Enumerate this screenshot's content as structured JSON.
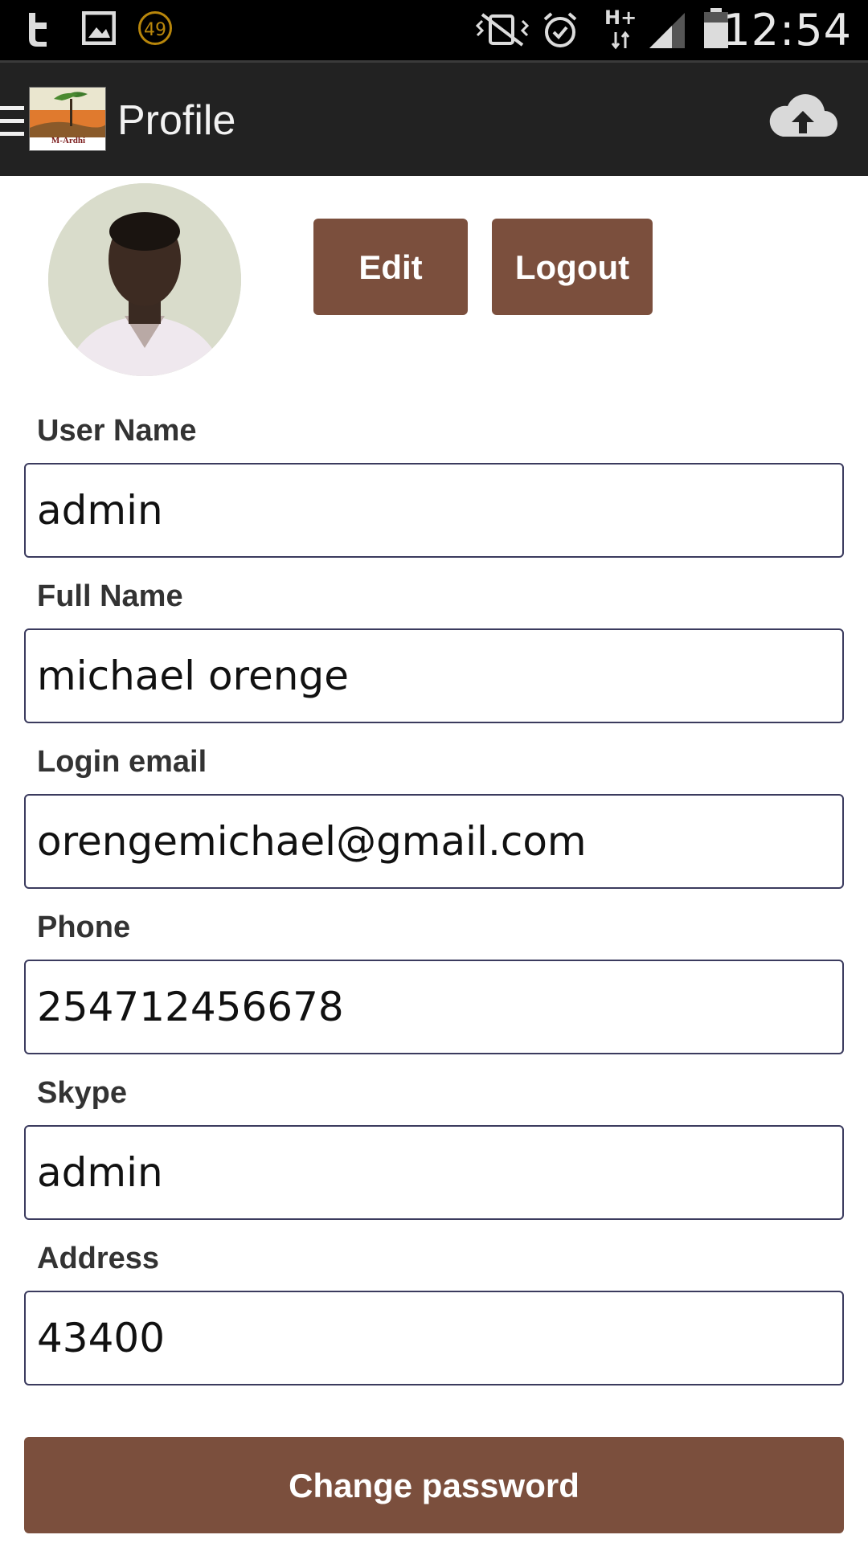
{
  "status_bar": {
    "time": "12:54",
    "badge_count": "49",
    "network_label": "H+",
    "icons": [
      "app-t-icon",
      "gallery-icon",
      "badge-49-icon",
      "vibrate-icon",
      "alarm-icon",
      "network-icon",
      "signal-icon",
      "battery-icon"
    ]
  },
  "app_bar": {
    "title": "Profile",
    "logo_text": "M-Ardhi",
    "icons": [
      "menu-icon",
      "cloud-upload-icon"
    ]
  },
  "profile": {
    "edit_label": "Edit",
    "logout_label": "Logout"
  },
  "fields": [
    {
      "label": "User Name",
      "value": "admin"
    },
    {
      "label": "Full Name",
      "value": "michael orenge"
    },
    {
      "label": "Login email",
      "value": "orengemichael@gmail.com"
    },
    {
      "label": "Phone",
      "value": "254712456678"
    },
    {
      "label": "Skype",
      "value": "admin"
    },
    {
      "label": "Address",
      "value": "43400"
    }
  ],
  "actions": {
    "change_password_label": "Change password"
  },
  "colors": {
    "accent": "#7b4f3d",
    "app_bar": "#222222",
    "status_bar": "#000000",
    "input_border": "#3b3b5e"
  }
}
